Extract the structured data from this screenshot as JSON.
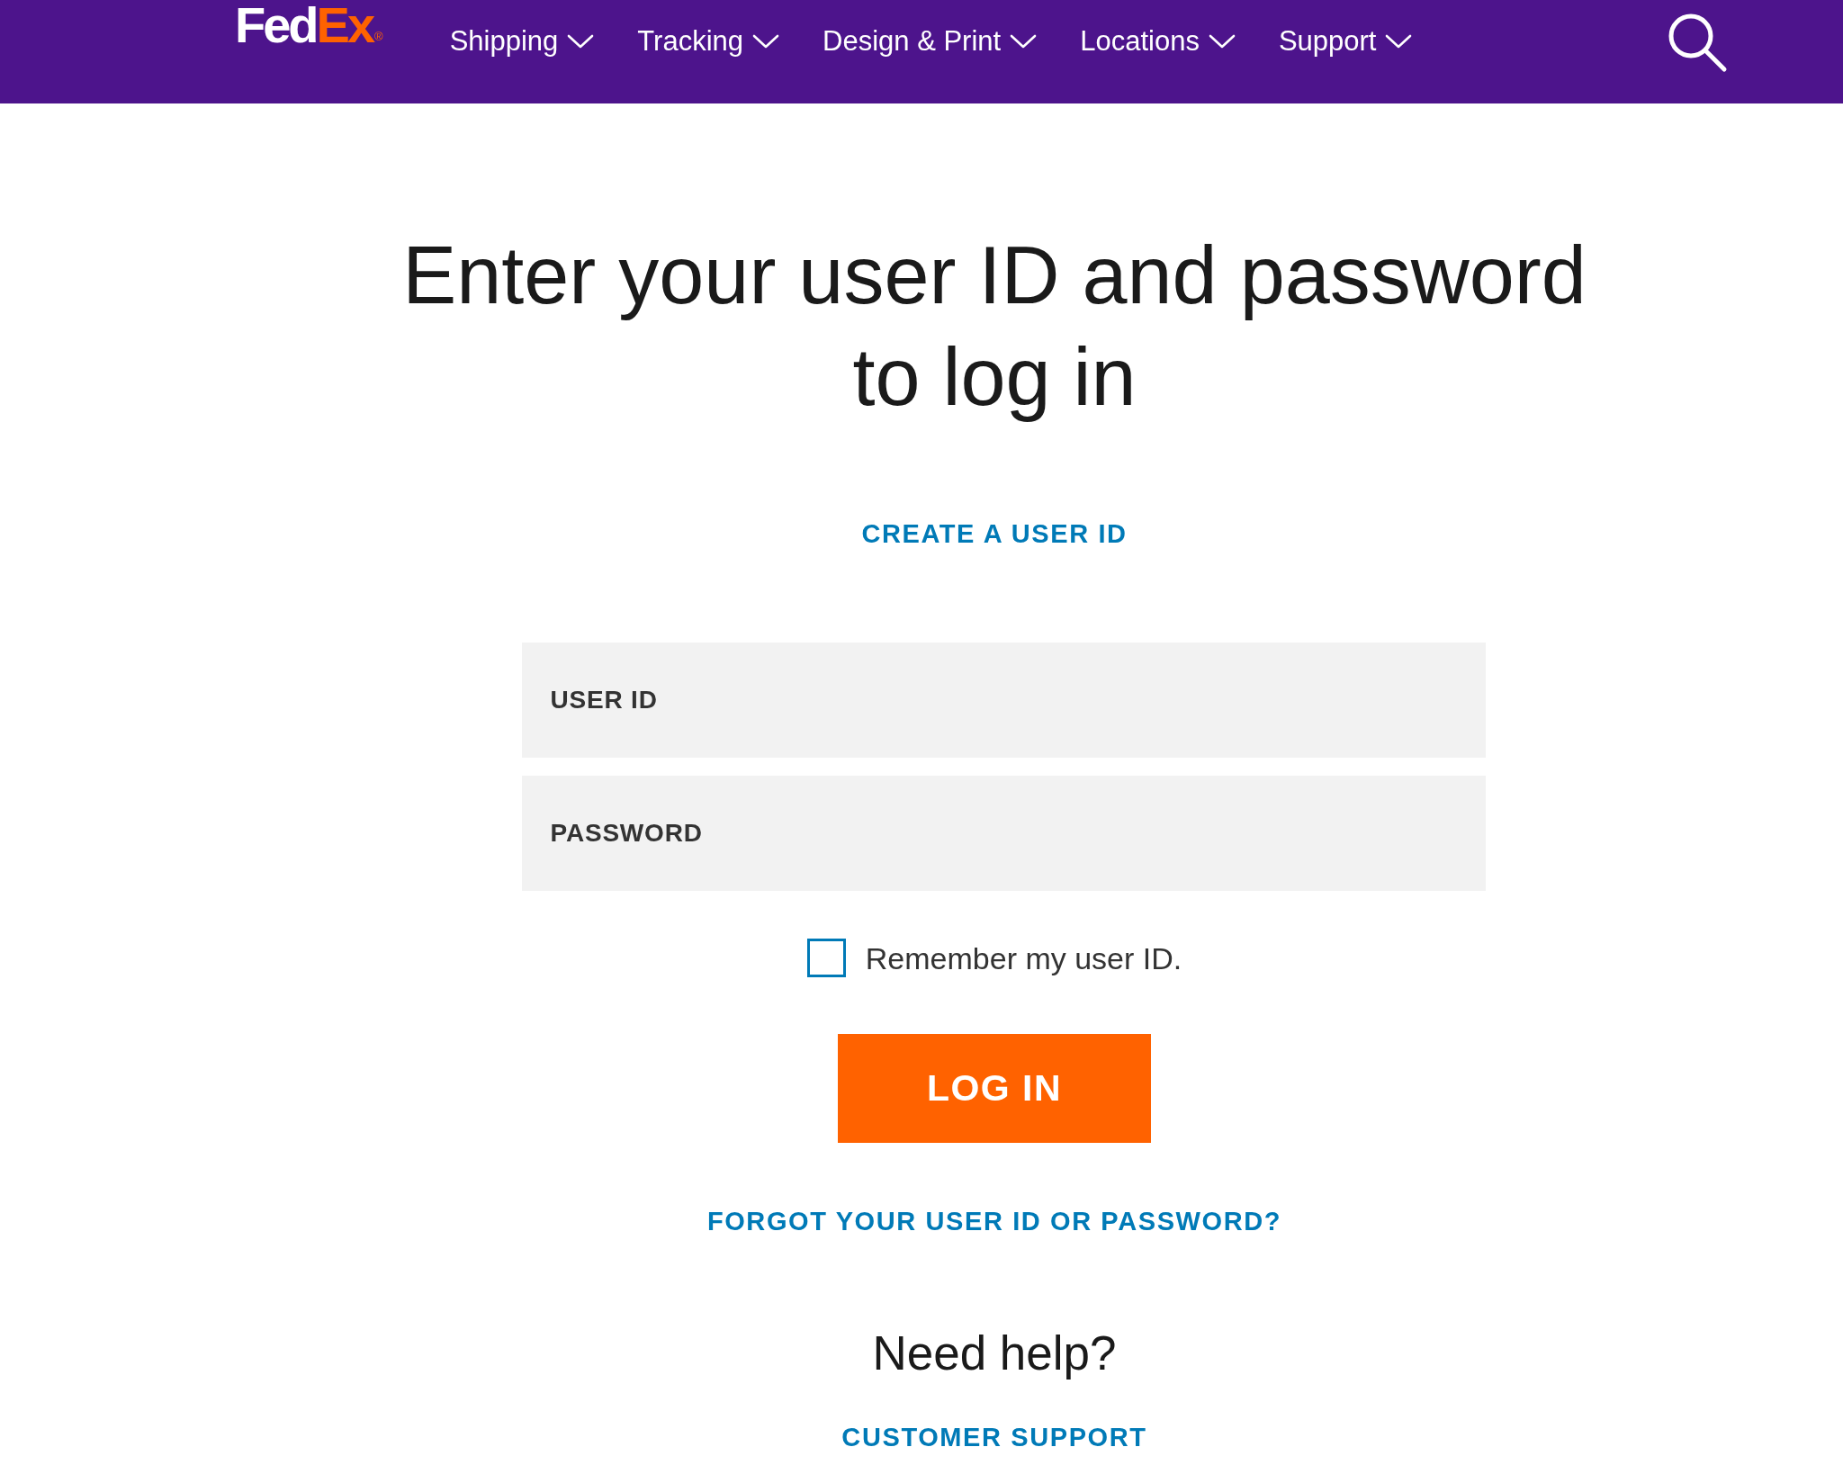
{
  "header": {
    "logo": {
      "parts": [
        {
          "text": "Fed",
          "color": "#ffffff"
        },
        {
          "text": "Ex",
          "color": "#ff6200"
        }
      ],
      "mark": "®"
    },
    "nav": [
      {
        "label": "Shipping",
        "expanded": false
      },
      {
        "label": "Tracking",
        "expanded": false
      },
      {
        "label": "Design & Print",
        "expanded": false
      },
      {
        "label": "Locations",
        "expanded": false
      },
      {
        "label": "Support",
        "expanded": false
      }
    ]
  },
  "login": {
    "title": "Enter your user ID and password to log in",
    "create_link": "CREATE A USER ID",
    "fields": [
      {
        "placeholder": "USER ID"
      },
      {
        "placeholder": "PASSWORD"
      }
    ],
    "remember": {
      "label": "Remember my user ID.",
      "checked": false
    },
    "submit": "LOG IN",
    "forgot_link": "FORGOT YOUR USER ID OR PASSWORD?"
  },
  "help": {
    "title": "Need help?",
    "link": "CUSTOMER SUPPORT"
  }
}
